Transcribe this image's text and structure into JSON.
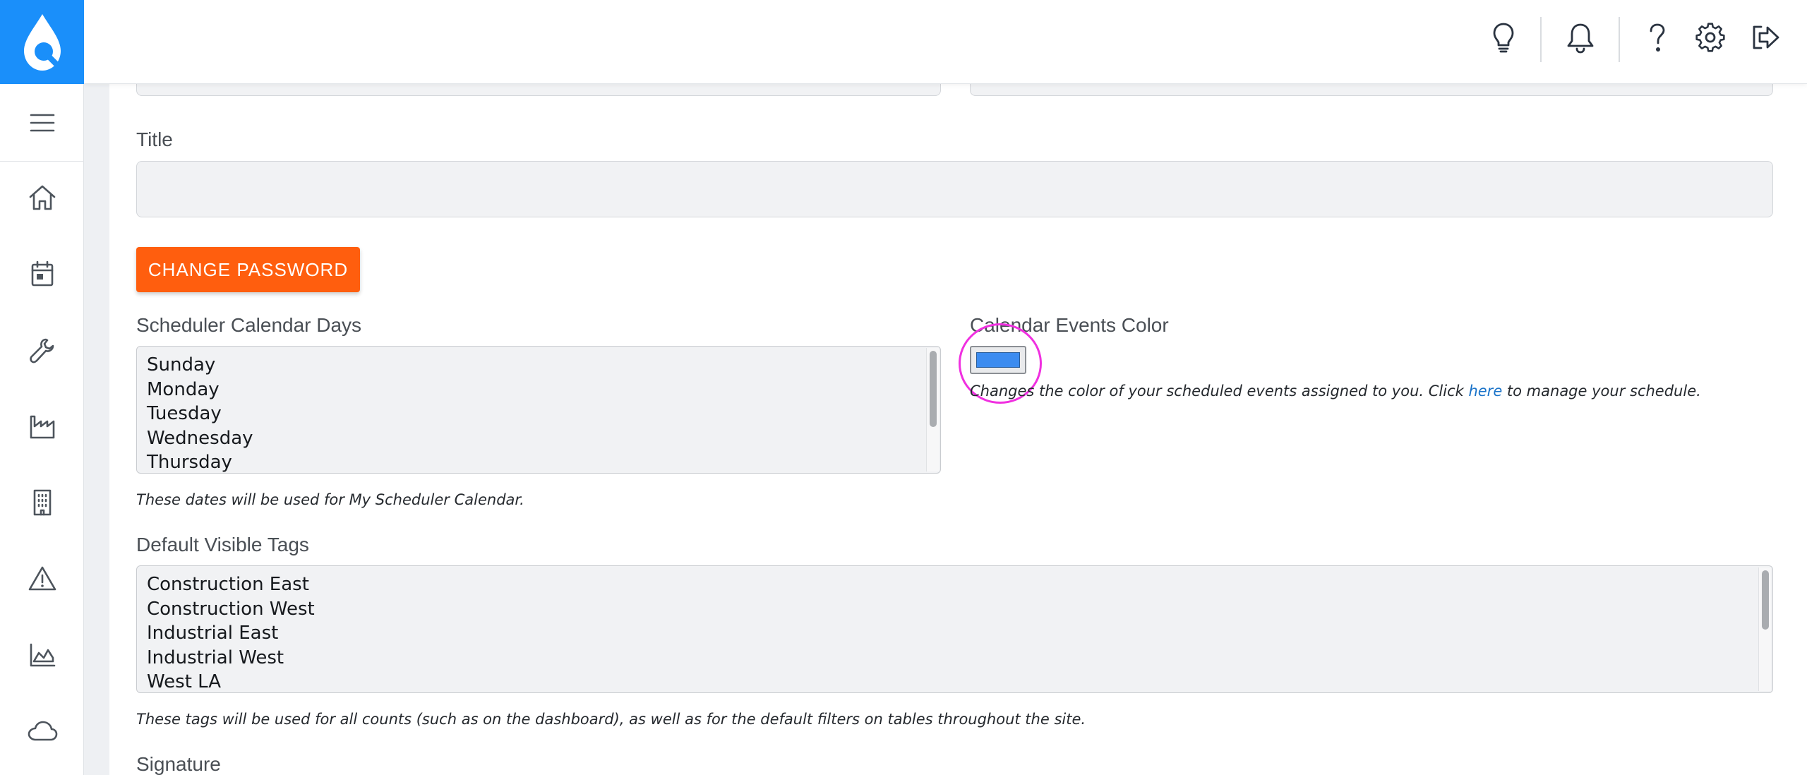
{
  "app": {
    "brand_color": "#1a8ffa",
    "logo_icon": "droplet-magnify-logo-icon"
  },
  "sidebar": {
    "menu_icon": "hamburger-menu-icon",
    "items": [
      {
        "icon": "home-icon"
      },
      {
        "icon": "calendar-icon"
      },
      {
        "icon": "wrench-icon"
      },
      {
        "icon": "factory-icon"
      },
      {
        "icon": "building-icon"
      },
      {
        "icon": "warning-icon"
      },
      {
        "icon": "area-chart-icon"
      },
      {
        "icon": "cloud-icon"
      }
    ]
  },
  "topbar": {
    "icons": [
      "lightbulb-icon",
      "bell-icon",
      "help-icon",
      "settings-gear-icon",
      "logout-icon"
    ]
  },
  "form": {
    "title": {
      "label": "Title",
      "value": ""
    },
    "change_password_label": "CHANGE PASSWORD",
    "scheduler_days": {
      "label": "Scheduler Calendar Days",
      "options": [
        "Sunday",
        "Monday",
        "Tuesday",
        "Wednesday",
        "Thursday"
      ],
      "help": "These dates will be used for My Scheduler Calendar."
    },
    "events_color": {
      "label": "Calendar Events Color",
      "value": "#3c8cf0",
      "help_before": "Changes the color of your scheduled events assigned to you. Click ",
      "help_link": "here",
      "help_after": " to manage your schedule."
    },
    "visible_tags": {
      "label": "Default Visible Tags",
      "options": [
        "Construction East",
        "Construction West",
        "Industrial East",
        "Industrial West",
        "West LA"
      ],
      "help": "These tags will be used for all counts (such as on the dashboard), as well as for the default filters on tables throughout the site."
    },
    "signature": {
      "label": "Signature"
    }
  },
  "colors": {
    "primary_button": "#ff5e0e",
    "link": "#1a73c9",
    "annotation_ring": "#f030e0"
  }
}
